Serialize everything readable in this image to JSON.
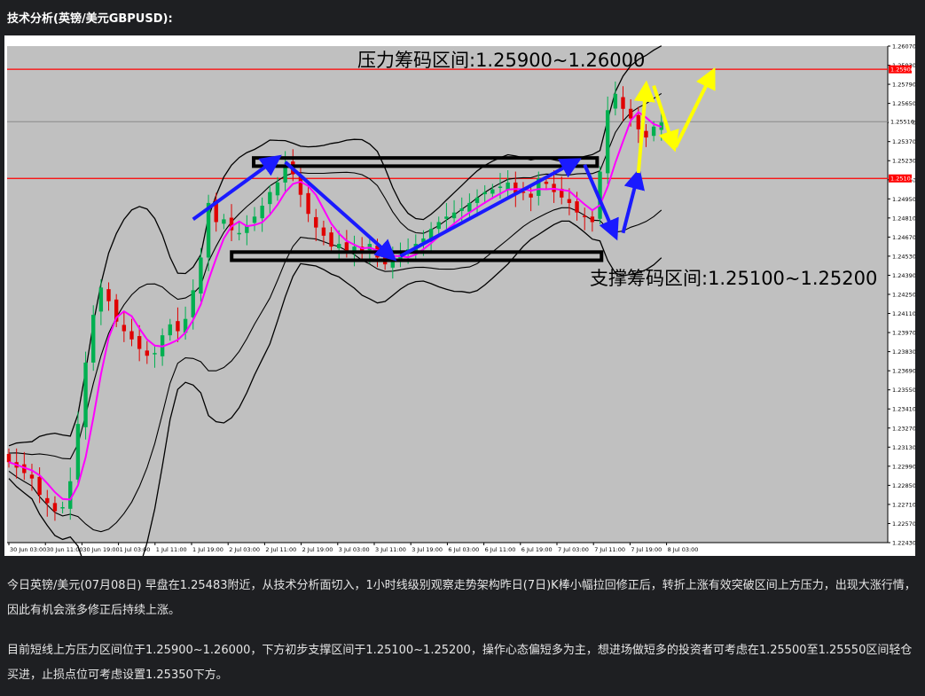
{
  "article": {
    "heading": "技术分析(英镑/美元GBPUSD):",
    "paragraph1": "今日英镑/美元(07月08日) 早盘在1.25483附近，从技术分析面切入，1小时线级别观察走势架构昨日(7日)K棒小幅拉回修正后，转折上涨有效突破区间上方压力，出现大涨行情，因此有机会涨多修正后持续上涨。",
    "paragraph2": "目前短线上方压力区间位于1.25900~1.26000，下方初步支撑区间于1.25100~1.25200，操作心态偏短多为主，想进场做短多的投资者可考虑在1.25500至1.25550区间轻仓买进，止损点位可考虑设置1.25350下方。"
  },
  "chart_data": {
    "type": "candlestick",
    "symbol": "GBPUSD",
    "timeframe": "1 hour",
    "ylim": [
      1.2243,
      1.2607
    ],
    "yticks": [
      "1.26070",
      "1.25930",
      "1.25790",
      "1.25650",
      "1.25510",
      "1.25370",
      "1.25230",
      "1.25090",
      "1.24950",
      "1.24810",
      "1.24670",
      "1.24530",
      "1.24390",
      "1.24250",
      "1.24110",
      "1.23970",
      "1.23830",
      "1.23690",
      "1.23550",
      "1.23410",
      "1.23270",
      "1.23130",
      "1.22990",
      "1.22850",
      "1.22710",
      "1.22570",
      "1.22430"
    ],
    "xticks": [
      "30 Jun 03:00",
      "30 Jun 11:00",
      "30 Jun 19:00",
      "1 Jul 03:00",
      "1 Jul 11:00",
      "1 Jul 19:00",
      "2 Jul 03:00",
      "2 Jul 11:00",
      "2 Jul 19:00",
      "3 Jul 03:00",
      "3 Jul 11:00",
      "3 Jul 19:00",
      "6 Jul 03:00",
      "6 Jul 11:00",
      "6 Jul 19:00",
      "7 Jul 03:00",
      "7 Jul 11:00",
      "7 Jul 19:00",
      "8 Jul 03:00"
    ],
    "resistance_label": "压力筹码区间:1.25900~1.26000",
    "support_label": "支撑筹码区间:1.25100~1.25200",
    "upper_line": {
      "value": 1.259,
      "label": "1.25900",
      "color": "#ff0000"
    },
    "lower_line": {
      "value": 1.251,
      "label": "1.25104",
      "color": "#ff0000"
    },
    "current_price": {
      "value": 1.25516,
      "label": "1.25516"
    },
    "upper_box": {
      "x_start": 0.28,
      "x_end": 0.67,
      "y_top": 1.2525,
      "y_bottom": 1.2519
    },
    "lower_box": {
      "x_start": 0.255,
      "x_end": 0.675,
      "y_top": 1.2456,
      "y_bottom": 1.245
    },
    "closes": [
      1.2302,
      1.2298,
      1.2294,
      1.229,
      1.2278,
      1.2272,
      1.2266,
      1.2269,
      1.2288,
      1.233,
      1.2375,
      1.241,
      1.243,
      1.242,
      1.2405,
      1.2398,
      1.2392,
      1.2385,
      1.238,
      1.2382,
      1.2395,
      1.2403,
      1.2398,
      1.2407,
      1.2428,
      1.2452,
      1.2492,
      1.2478,
      1.248,
      1.2472,
      1.247,
      1.2475,
      1.2482,
      1.249,
      1.25,
      1.2507,
      1.252,
      1.2513,
      1.2498,
      1.2484,
      1.2474,
      1.2468,
      1.246,
      1.2462,
      1.2457,
      1.246,
      1.2455,
      1.2462,
      1.2452,
      1.2447,
      1.245,
      1.2454,
      1.2458,
      1.2462,
      1.2466,
      1.2473,
      1.2478,
      1.2482,
      1.2485,
      1.2488,
      1.2492,
      1.2496,
      1.25,
      1.2502,
      1.2504,
      1.2507,
      1.2498,
      1.25,
      1.2496,
      1.251,
      1.2506,
      1.25,
      1.2496,
      1.2492,
      1.2485,
      1.2482,
      1.2478,
      1.2515,
      1.256,
      1.2572,
      1.2561,
      1.2554,
      1.2546,
      1.254,
      1.2548,
      1.2551
    ],
    "colors": {
      "bull": "#00b050",
      "bear": "#e00000",
      "ma": "#ff00ff",
      "bands": "#000000",
      "arrows": "#1a1aff",
      "projection": "#ffff00"
    }
  }
}
